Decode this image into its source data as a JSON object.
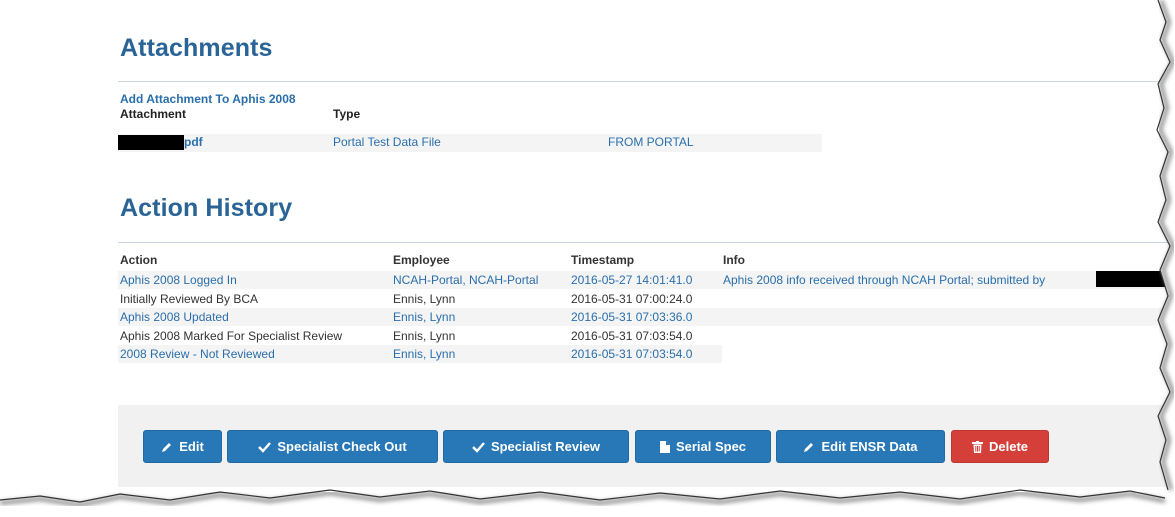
{
  "attachments": {
    "title": "Attachments",
    "add_link": "Add Attachment To Aphis 2008",
    "headers": {
      "attachment": "Attachment",
      "type": "Type"
    },
    "row": {
      "file_suffix": "pdf",
      "type": "Portal Test Data File",
      "source": "FROM PORTAL"
    }
  },
  "action_history": {
    "title": "Action History",
    "headers": {
      "action": "Action",
      "employee": "Employee",
      "timestamp": "Timestamp",
      "info": "Info"
    },
    "rows": [
      {
        "action": "Aphis 2008 Logged In",
        "employee": "NCAH-Portal, NCAH-Portal",
        "timestamp": "2016-05-27 14:01:41.0",
        "info": "Aphis 2008 info received through NCAH Portal; submitted by"
      },
      {
        "action": "Initially Reviewed By BCA",
        "employee": "Ennis, Lynn",
        "timestamp": "2016-05-31 07:00:24.0",
        "info": ""
      },
      {
        "action": "Aphis 2008 Updated",
        "employee": "Ennis, Lynn",
        "timestamp": "2016-05-31 07:03:36.0",
        "info": ""
      },
      {
        "action": "Aphis 2008 Marked For Specialist Review",
        "employee": "Ennis, Lynn",
        "timestamp": "2016-05-31 07:03:54.0",
        "info": ""
      },
      {
        "action": "2008 Review - Not Reviewed",
        "employee": "Ennis, Lynn",
        "timestamp": "2016-05-31 07:03:54.0",
        "info": ""
      }
    ]
  },
  "buttons": {
    "edit": "Edit",
    "specialist_check_out": "Specialist Check Out",
    "specialist_review": "Specialist Review",
    "serial_spec": "Serial Spec",
    "edit_ensr": "Edit ENSR Data",
    "delete": "Delete"
  },
  "colors": {
    "link": "#2a6fab",
    "primary": "#2878b8",
    "danger": "#d43f3a"
  }
}
